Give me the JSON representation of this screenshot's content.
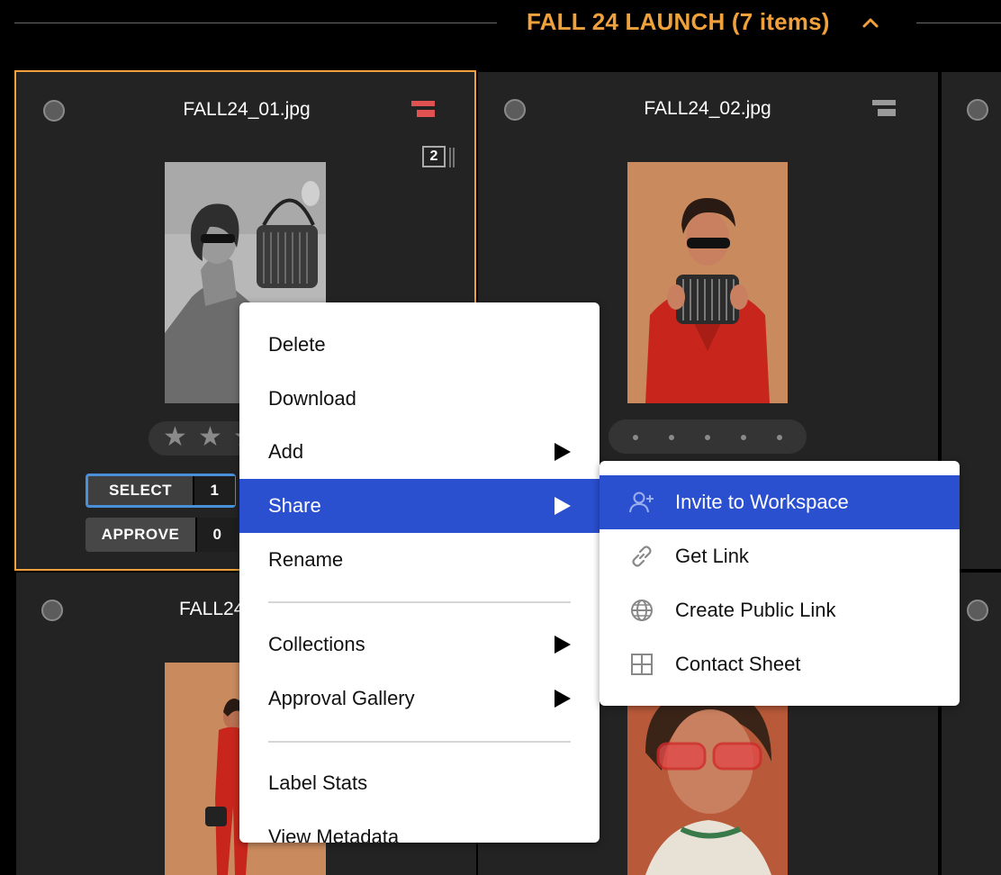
{
  "group": {
    "title": "FALL 24 LAUNCH (7 items)",
    "accent_color": "#f0a13b",
    "collapse_icon": "chevron-up-icon"
  },
  "cards": [
    {
      "filename": "FALL24_01.jpg",
      "version_count": "2",
      "stack_icon_color": "#e05252",
      "rating_stars": 3,
      "labels": [
        {
          "name": "SELECT",
          "count": "1"
        },
        {
          "name": "APPROVE",
          "count": "0"
        }
      ]
    },
    {
      "filename": "FALL24_02.jpg",
      "stack_icon_color": "#9a9a9a"
    },
    {
      "filename": "FALL24"
    }
  ],
  "context_menu": {
    "items": [
      {
        "label": "Delete"
      },
      {
        "label": "Download"
      },
      {
        "label": "Add",
        "has_submenu": true
      },
      {
        "label": "Share",
        "has_submenu": true,
        "highlighted": true
      },
      {
        "label": "Rename"
      },
      {
        "label": "Collections",
        "has_submenu": true
      },
      {
        "label": "Approval Gallery",
        "has_submenu": true
      },
      {
        "label": "Label Stats"
      },
      {
        "label": "View Metadata"
      }
    ],
    "highlight_color": "#2a4fcf"
  },
  "share_submenu": {
    "items": [
      {
        "label": "Invite to Workspace",
        "icon": "add-user-icon",
        "highlighted": true
      },
      {
        "label": "Get Link",
        "icon": "link-icon"
      },
      {
        "label": "Create Public Link",
        "icon": "globe-icon"
      },
      {
        "label": "Contact Sheet",
        "icon": "grid-icon"
      }
    ]
  }
}
